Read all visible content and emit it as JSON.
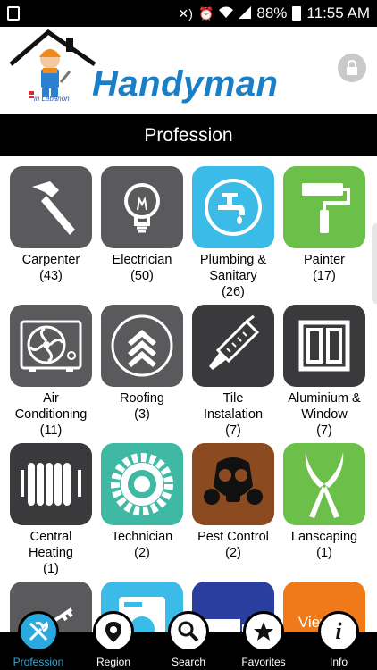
{
  "status": {
    "percent": "88%",
    "time": "11:55 AM"
  },
  "header": {
    "brand": "Handyman",
    "logo_caption": "in Lebanon"
  },
  "title": "Profession",
  "professions": [
    {
      "label": "Carpenter",
      "count": "(43)",
      "color": "#5a5a5c",
      "icon": "hammer-icon"
    },
    {
      "label": "Electrician",
      "count": "(50)",
      "color": "#5a5a5c",
      "icon": "lightbulb-icon"
    },
    {
      "label": "Plumbing &\nSanitary",
      "count": "(26)",
      "color": "#3bbbe8",
      "icon": "faucet-icon"
    },
    {
      "label": "Painter",
      "count": "(17)",
      "color": "#6cc04a",
      "icon": "paint-roller-icon"
    },
    {
      "label": "Air\nConditioning",
      "count": "(11)",
      "color": "#5a5a5c",
      "icon": "air-conditioner-icon"
    },
    {
      "label": "Roofing",
      "count": "(3)",
      "color": "#5a5a5c",
      "icon": "roofing-icon"
    },
    {
      "label": "Tile\nInstalation",
      "count": "(7)",
      "color": "#3a3a3c",
      "icon": "trowel-icon"
    },
    {
      "label": "Aluminium &\nWindow",
      "count": "(7)",
      "color": "#3a3a3c",
      "icon": "window-icon"
    },
    {
      "label": "Central\nHeating",
      "count": "(1)",
      "color": "#3a3a3c",
      "icon": "radiator-icon"
    },
    {
      "label": "Technician",
      "count": "(2)",
      "color": "#3fb9a4",
      "icon": "gear-icon"
    },
    {
      "label": "Pest Control",
      "count": "(2)",
      "color": "#8b4a1f",
      "icon": "gas-mask-icon"
    },
    {
      "label": "Lanscaping",
      "count": "(1)",
      "color": "#6cc04a",
      "icon": "shears-icon"
    }
  ],
  "partial_row": [
    {
      "color": "#5a5a5c",
      "icon": "keys-icon"
    },
    {
      "color": "#3bbbe8",
      "icon": "washing-machine-icon"
    },
    {
      "color": "#2a3ea0",
      "icon": "truck-icon"
    },
    {
      "color": "#f07a1a",
      "icon": "view-all-icon",
      "label": "View all"
    }
  ],
  "nav": [
    {
      "label": "Profession",
      "icon": "tools-icon",
      "active": true
    },
    {
      "label": "Region",
      "icon": "location-pin-icon",
      "active": false
    },
    {
      "label": "Search",
      "icon": "search-icon",
      "active": false
    },
    {
      "label": "Favorites",
      "icon": "star-icon",
      "active": false
    },
    {
      "label": "Info",
      "icon": "info-icon",
      "active": false
    }
  ]
}
